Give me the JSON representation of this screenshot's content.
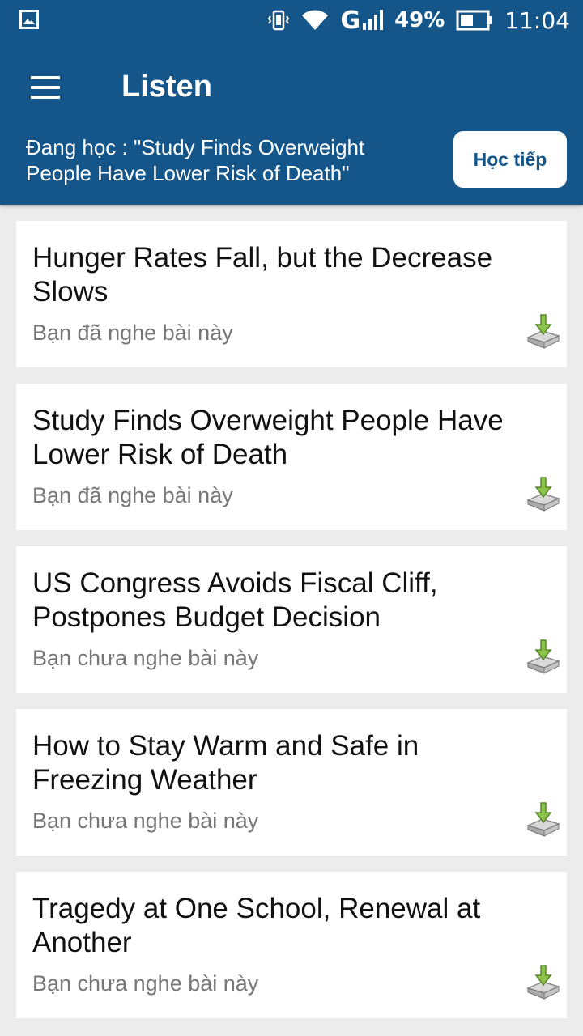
{
  "status_bar": {
    "network": "G",
    "battery": "49%",
    "time": "11:04",
    "icons": [
      "gallery-icon",
      "vibrate-icon",
      "wifi-icon",
      "signal-icon",
      "battery-icon"
    ]
  },
  "header": {
    "title": "Listen",
    "studying": "Đang học : \"Study Finds Overweight People Have Lower Risk of Death\"",
    "continue_label": "Học tiếp"
  },
  "lessons": [
    {
      "title": "Hunger Rates Fall, but the Decrease Slows",
      "status": "Bạn đã nghe bài này"
    },
    {
      "title": "Study Finds Overweight People Have Lower Risk of Death",
      "status": "Bạn đã nghe bài này"
    },
    {
      "title": "US Congress Avoids Fiscal Cliff, Postpones Budget Decision",
      "status": "Bạn chưa nghe bài này"
    },
    {
      "title": "How to Stay Warm and Safe in Freezing Weather",
      "status": "Bạn chưa nghe bài này"
    },
    {
      "title": "Tragedy at One School, Renewal at Another",
      "status": "Bạn chưa nghe bài này"
    }
  ],
  "colors": {
    "primary": "#14558a",
    "background": "#ececec",
    "card": "#ffffff",
    "subtext": "#777777",
    "download_arrow": "#8bc34a"
  }
}
